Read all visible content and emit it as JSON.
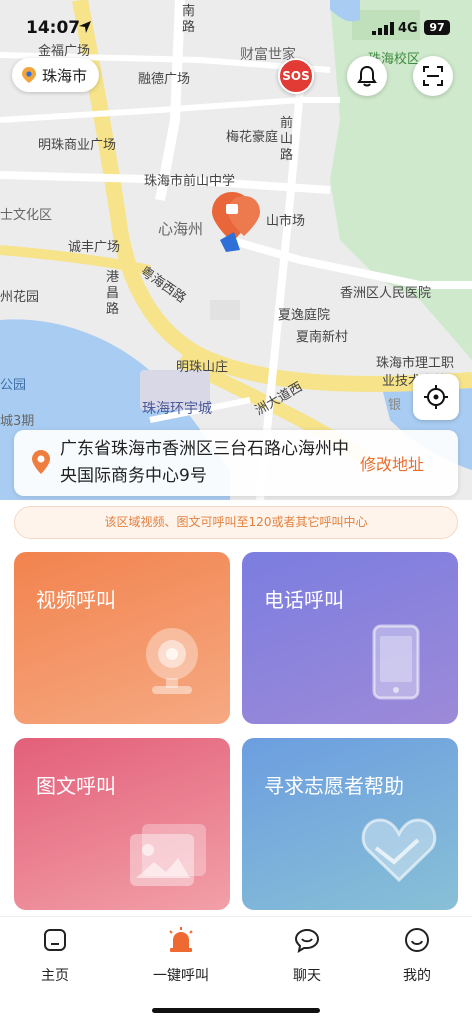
{
  "status_bar": {
    "time": "14:07",
    "network": "4G",
    "battery": "97"
  },
  "header": {
    "city": "珠海市",
    "sos_label": "SOS"
  },
  "map": {
    "labels": [
      {
        "text": "金福广场"
      },
      {
        "text": "融德广场"
      },
      {
        "text": "财富世家"
      },
      {
        "text": "珠海校区"
      },
      {
        "text": "梅花豪庭"
      },
      {
        "text": "明珠商业广场"
      },
      {
        "text": "前山路"
      },
      {
        "text": "珠海市前山中学"
      },
      {
        "text": "士文化区"
      },
      {
        "text": "心海州"
      },
      {
        "text": "山市场"
      },
      {
        "text": "诚丰广场"
      },
      {
        "text": "粤海西路"
      },
      {
        "text": "港昌路"
      },
      {
        "text": "香洲区人民医院"
      },
      {
        "text": "州花园"
      },
      {
        "text": "夏逸庭院"
      },
      {
        "text": "夏南新村"
      },
      {
        "text": "明珠山庄"
      },
      {
        "text": "珠海市理工职"
      },
      {
        "text": "业技术学校"
      },
      {
        "text": "公园"
      },
      {
        "text": "珠海环宇城"
      },
      {
        "text": "洲大道西"
      },
      {
        "text": "城3期"
      },
      {
        "text": "银"
      },
      {
        "text": "南路"
      }
    ]
  },
  "address": {
    "text": "广东省珠海市香洲区三台石路心海州中央国际商务中心9号",
    "edit_label": "修改地址"
  },
  "notice": "该区域视频、图文可呼叫至120或者其它呼叫中心",
  "call_options": [
    {
      "label": "视频呼叫",
      "icon": "webcam-icon",
      "color": "#f08f58"
    },
    {
      "label": "电话呼叫",
      "icon": "phone-icon",
      "color": "#8a80db"
    },
    {
      "label": "图文呼叫",
      "icon": "photo-icon",
      "color": "#e77e8e"
    },
    {
      "label": "寻求志愿者帮助",
      "icon": "heart-hands-icon",
      "color": "#74a7d8"
    }
  ],
  "tabs": [
    {
      "label": "主页",
      "icon": "home-icon",
      "active": false
    },
    {
      "label": "一键呼叫",
      "icon": "siren-icon",
      "active": true
    },
    {
      "label": "聊天",
      "icon": "chat-icon",
      "active": false
    },
    {
      "label": "我的",
      "icon": "profile-icon",
      "active": false
    }
  ]
}
